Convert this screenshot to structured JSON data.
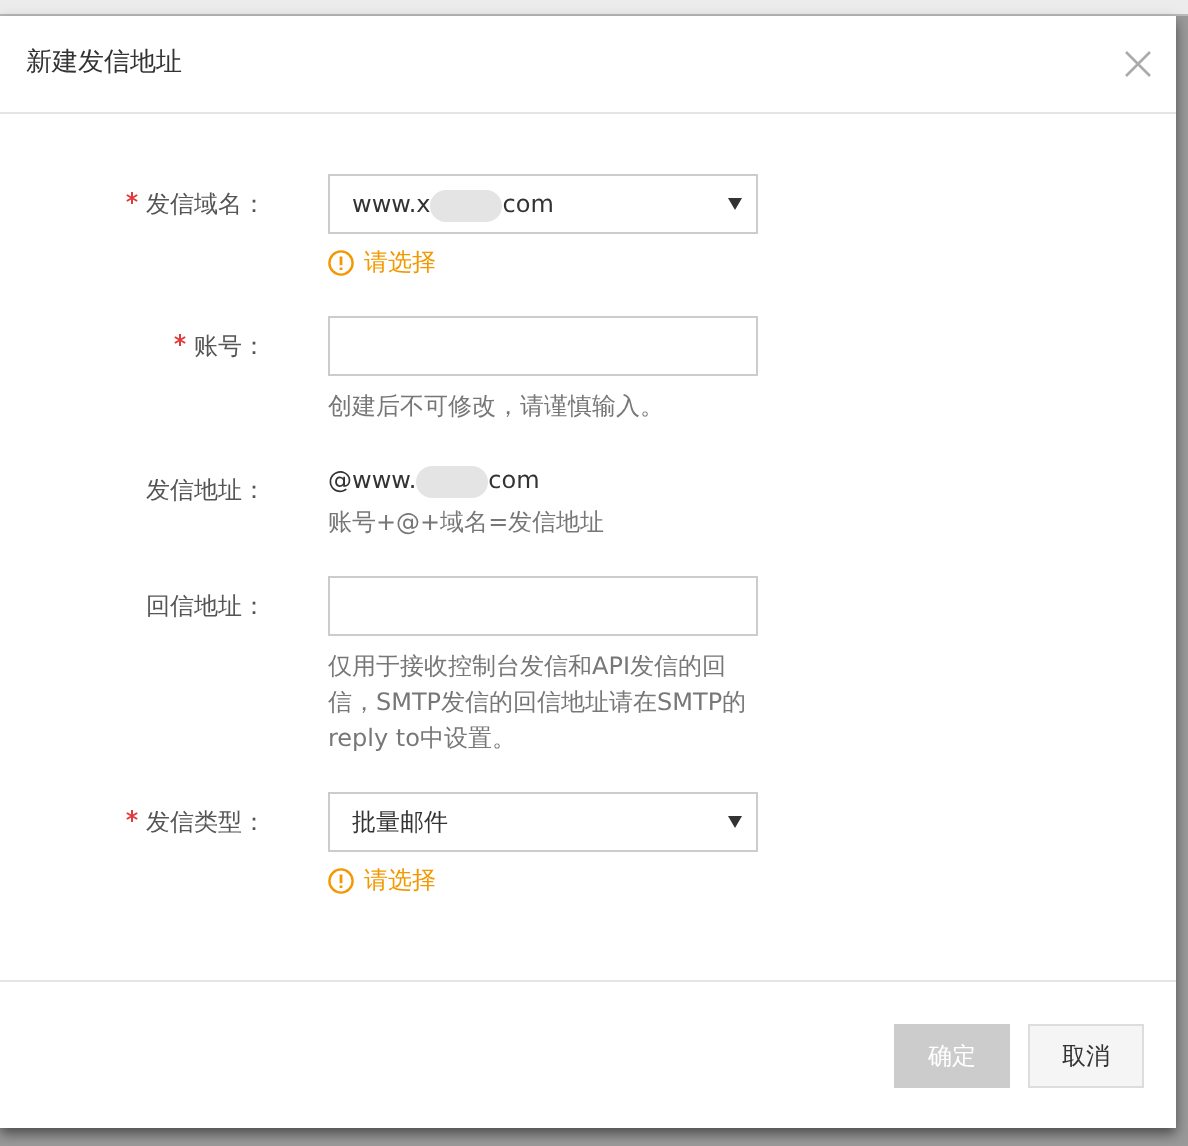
{
  "dialog": {
    "title": "新建发信地址",
    "fields": [
      {
        "kind": "select",
        "label": "发信域名：",
        "required": true,
        "value_parts": [
          "www.x",
          "com"
        ],
        "error": "请选择"
      },
      {
        "kind": "input",
        "label": "账号：",
        "required": true,
        "hint": "创建后不可修改，请谨慎输入。"
      },
      {
        "kind": "text",
        "label": "发信地址：",
        "required": false,
        "value_parts": [
          "@www.",
          "com"
        ],
        "hint": "账号+@+域名=发信地址"
      },
      {
        "kind": "input",
        "label": "回信地址：",
        "required": false,
        "hint": "仅用于接收控制台发信和API发信的回信，SMTP发信的回信地址请在SMTP的reply to中设置。"
      },
      {
        "kind": "select",
        "label": "发信类型：",
        "required": true,
        "value_parts": [
          "批量邮件"
        ],
        "error": "请选择"
      }
    ],
    "buttons": [
      {
        "label": "确定",
        "kind": "primary",
        "disabled": true
      },
      {
        "label": "取消",
        "kind": "default",
        "disabled": false
      }
    ]
  }
}
